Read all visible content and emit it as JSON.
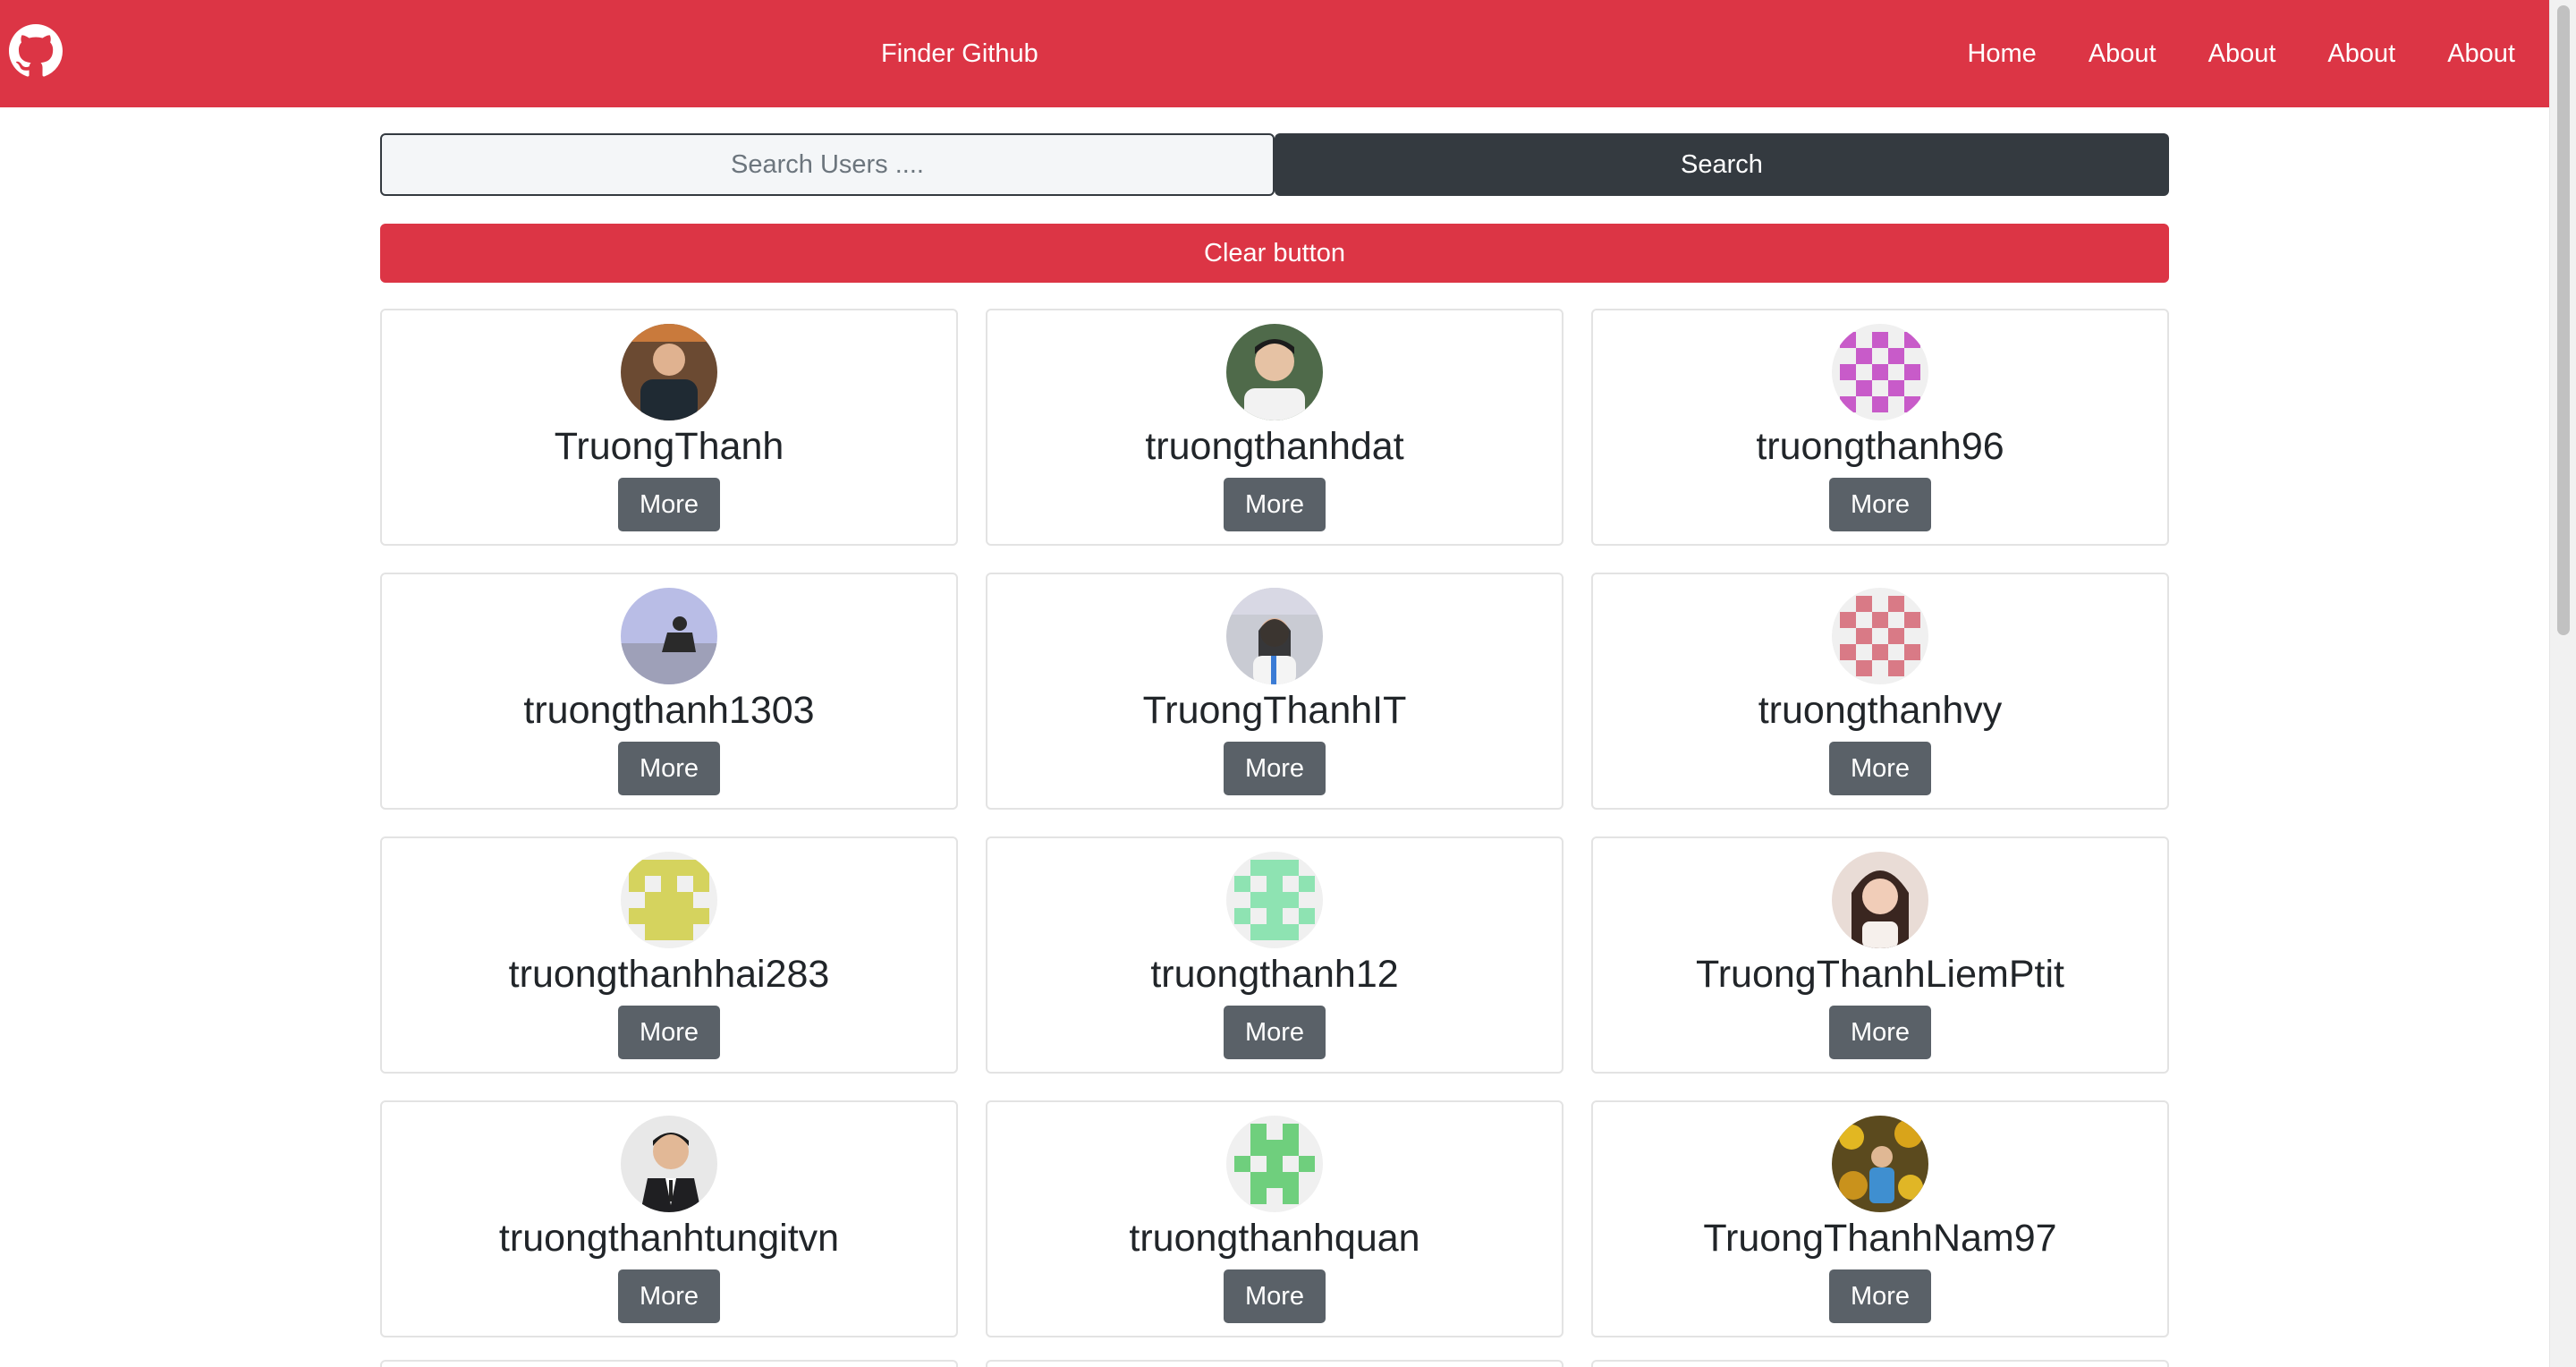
{
  "navbar": {
    "logo_icon": "github-icon",
    "title": "Finder Github",
    "links": [
      "Home",
      "About",
      "About",
      "About",
      "About"
    ],
    "color": "#dc3545"
  },
  "search": {
    "placeholder": "Search Users ....",
    "value": "",
    "button_label": "Search",
    "clear_label": "Clear button"
  },
  "users": [
    {
      "login": "TruongThanh",
      "more_label": "More",
      "avatar": "photo"
    },
    {
      "login": "truongthanhdat",
      "more_label": "More",
      "avatar": "photo"
    },
    {
      "login": "truongthanh96",
      "more_label": "More",
      "avatar": "identicon",
      "identicon_color": "#c85bc9"
    },
    {
      "login": "truongthanh1303",
      "more_label": "More",
      "avatar": "photo"
    },
    {
      "login": "TruongThanhIT",
      "more_label": "More",
      "avatar": "photo"
    },
    {
      "login": "truongthanhvy",
      "more_label": "More",
      "avatar": "identicon",
      "identicon_color": "#d97a86"
    },
    {
      "login": "truongthanhhai283",
      "more_label": "More",
      "avatar": "identicon",
      "identicon_color": "#d5d35e"
    },
    {
      "login": "truongthanh12",
      "more_label": "More",
      "avatar": "identicon",
      "identicon_color": "#8ee3b2"
    },
    {
      "login": "TruongThanhLiemPtit",
      "more_label": "More",
      "avatar": "photo"
    },
    {
      "login": "truongthanhtungitvn",
      "more_label": "More",
      "avatar": "photo"
    },
    {
      "login": "truongthanhquan",
      "more_label": "More",
      "avatar": "identicon",
      "identicon_color": "#6fcf7d"
    },
    {
      "login": "TruongThanhNam97",
      "more_label": "More",
      "avatar": "photo"
    }
  ]
}
